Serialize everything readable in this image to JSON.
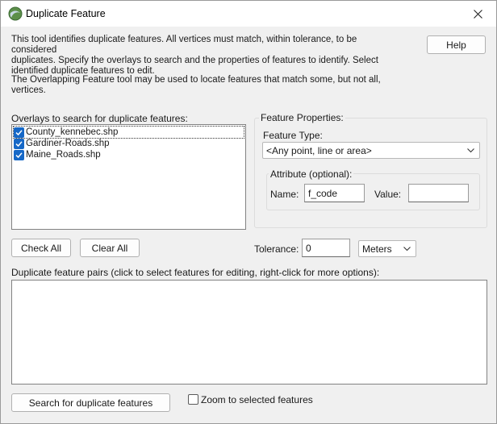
{
  "window": {
    "title": "Duplicate Feature",
    "icon": "globe-app-icon",
    "close_icon": "close-icon"
  },
  "description": {
    "line1": "This tool identifies duplicate features. All vertices must match, within tolerance, to be considered",
    "line2": "duplicates. Specify the overlays to search and the properties of features to identify. Select",
    "line3": "identified duplicate features to edit.",
    "para2_line1": "The Overlapping Feature tool may be used to locate features that match some, but not all,",
    "para2_line2": "vertices."
  },
  "help_label": "Help",
  "overlays": {
    "label": "Overlays to search for duplicate features:",
    "items": [
      {
        "name": "County_kennebec.shp",
        "checked": true
      },
      {
        "name": "Gardiner-Roads.shp",
        "checked": true
      },
      {
        "name": "Maine_Roads.shp",
        "checked": true
      }
    ]
  },
  "feature_properties": {
    "label": "Feature Properties:",
    "type_label": "Feature Type:",
    "type_value": "<Any point, line or area>",
    "attribute_label": "Attribute (optional):",
    "name_label": "Name:",
    "name_value": "f_code",
    "value_label": "Value:",
    "value_value": ""
  },
  "check_all_label": "Check All",
  "clear_all_label": "Clear All",
  "tolerance": {
    "label": "Tolerance:",
    "value": "0",
    "unit": "Meters"
  },
  "results": {
    "label": "Duplicate feature pairs (click to select features for editing, right-click for more options):"
  },
  "search_label": "Search for duplicate features",
  "zoom_label": "Zoom to selected features",
  "zoom_checked": false
}
